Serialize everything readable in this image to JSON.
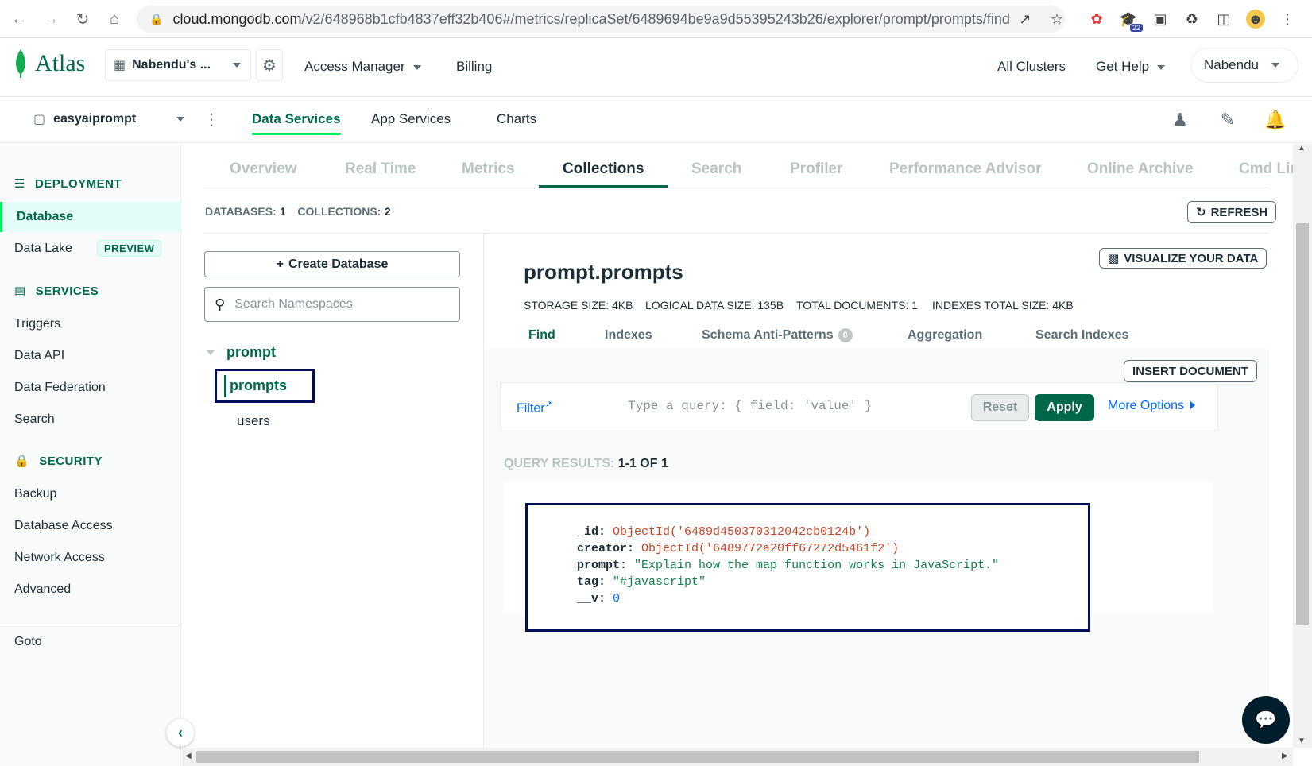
{
  "browser": {
    "url_host": "cloud.mongodb.com",
    "url_path": "/v2/648968b1cfb4837eff32b406#/metrics/replicaSet/6489694be9a9d55395243b26/explorer/prompt/prompts/find",
    "ext_badge": "22"
  },
  "topnav": {
    "logo": "Atlas",
    "org": "Nabendu's ...",
    "access_manager": "Access Manager",
    "billing": "Billing",
    "all_clusters": "All Clusters",
    "get_help": "Get Help",
    "user": "Nabendu"
  },
  "projnav": {
    "project": "easyaiprompt",
    "tabs": [
      "Data Services",
      "App Services",
      "Charts"
    ]
  },
  "sidebar": {
    "deployment": "DEPLOYMENT",
    "database": "Database",
    "data_lake": "Data Lake",
    "preview": "PREVIEW",
    "services": "SERVICES",
    "triggers": "Triggers",
    "data_api": "Data API",
    "data_federation": "Data Federation",
    "search": "Search",
    "security": "SECURITY",
    "backup": "Backup",
    "database_access": "Database Access",
    "network_access": "Network Access",
    "advanced": "Advanced",
    "goto": "Goto"
  },
  "main": {
    "tabs": [
      "Overview",
      "Real Time",
      "Metrics",
      "Collections",
      "Search",
      "Profiler",
      "Performance Advisor",
      "Online Archive",
      "Cmd Lir"
    ],
    "databases_label": "DATABASES:",
    "databases_count": "1",
    "collections_label": "COLLECTIONS:",
    "collections_count": "2",
    "refresh": "REFRESH",
    "create_database": "Create Database",
    "search_placeholder": "Search Namespaces",
    "db_name": "prompt",
    "collections": [
      "prompts",
      "users"
    ]
  },
  "collection": {
    "title": "prompt.prompts",
    "visualize": "VISUALIZE YOUR DATA",
    "stats": [
      "STORAGE SIZE: 4KB",
      "LOGICAL DATA SIZE: 135B",
      "TOTAL DOCUMENTS: 1",
      "INDEXES TOTAL SIZE: 4KB"
    ],
    "tabs": [
      "Find",
      "Indexes",
      "Schema Anti-Patterns",
      "Aggregation",
      "Search Indexes"
    ],
    "anti_patterns_badge": "0",
    "insert_document": "INSERT DOCUMENT",
    "filter": "Filter",
    "query_placeholder": "Type a query: { field: 'value' }",
    "reset": "Reset",
    "apply": "Apply",
    "more_options": "More Options",
    "results_label": "QUERY RESULTS:",
    "results_count": "1-1 OF 1",
    "document": {
      "id_key": "_id:",
      "id_val": "ObjectId('6489d450370312042cb0124b')",
      "creator_key": "creator:",
      "creator_val": "ObjectId('6489772a20ff67272d5461f2')",
      "prompt_key": "prompt:",
      "prompt_val": "\"Explain how the map function works in JavaScript.\"",
      "tag_key": "tag:",
      "tag_val": "\"#javascript\"",
      "v_key": "__v:",
      "v_val": "0"
    }
  },
  "colors": {
    "brand_green": "#00684a",
    "accent_green": "#00ed64",
    "highlight_box": "#000f5c",
    "link_blue": "#016bf8"
  }
}
